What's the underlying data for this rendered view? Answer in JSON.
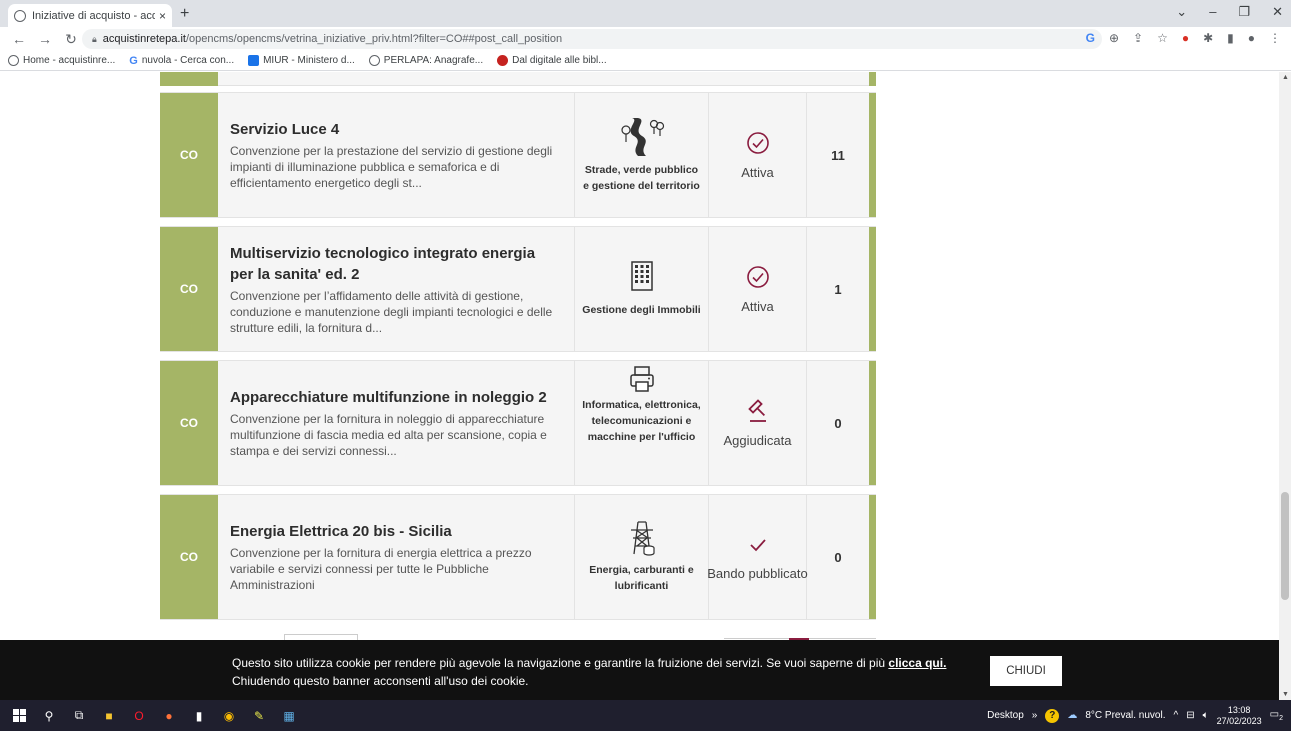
{
  "browser": {
    "tab_title": "Iniziative di acquisto - acquistinr",
    "tab_close": "×",
    "new_tab": "+",
    "url_host": "acquistinretepa.it",
    "url_path": "/opencms/opencms/vetrina_iniziative_priv.html?filter=CO##post_call_position",
    "bookmarks": [
      {
        "label": "Home - acquistinre...",
        "color": "#5f6368"
      },
      {
        "label": "nuvola - Cerca con...",
        "color": "#4285f4"
      },
      {
        "label": "MIUR - Ministero d...",
        "color": "#1a73e8"
      },
      {
        "label": "PERLAPA: Anagrafe...",
        "color": "#5f6368"
      },
      {
        "label": "Dal digitale alle bibl...",
        "color": "#c5221f"
      }
    ]
  },
  "cards": [
    {
      "code": "CO",
      "title": "Servizio Luce 4",
      "description": "Convenzione per la prestazione del servizio di gestione degli impianti di illuminazione pubblica e semaforica e di efficientamento energetico degli st...",
      "category_icon": "road-trees-icon",
      "category": "Strade, verde pubblico e gestione del territorio",
      "status_icon": "check-circle-icon",
      "status": "Attiva",
      "count": "11"
    },
    {
      "code": "CO",
      "title": "Multiservizio tecnologico integrato energia per la sanita' ed. 2",
      "description": "Convenzione per l’affidamento delle attività di gestione, conduzione e manutenzione degli impianti tecnologici e delle strutture edili, la fornitura d...",
      "category_icon": "building-icon",
      "category": "Gestione degli Immobili",
      "status_icon": "check-circle-icon",
      "status": "Attiva",
      "count": "1"
    },
    {
      "code": "CO",
      "title": "Apparecchiature multifunzione in noleggio 2",
      "description": "Convenzione per la fornitura in noleggio di apparecchiature multifunzione di fascia media ed alta per scansione, copia e stampa e dei servizi connessi...",
      "category_icon": "printer-icon",
      "category": "Informatica, elettronica, telecomunicazioni e macchine per l'ufficio",
      "status_icon": "gavel-icon",
      "status": "Aggiudicata",
      "count": "0"
    },
    {
      "code": "CO",
      "title": "Energia Elettrica 20 bis - Sicilia",
      "description": "Convenzione per la fornitura di energia elettrica a prezzo variabile e servizi connessi per tutte le Pubbliche Amministrazioni",
      "category_icon": "power-tower-icon",
      "category": "Energia, carburanti e lubrificanti",
      "status_icon": "checkmark-icon",
      "status": "Bando pubblicato",
      "count": "0"
    }
  ],
  "cookie": {
    "text_before": "Questo sito utilizza cookie per rendere più agevole la navigazione e garantire la fruizione dei servizi. Se vuoi saperne di più ",
    "link": "clicca qui.",
    "text_after": "Chiudendo questo banner acconsenti all'uso dei cookie.",
    "button": "CHIUDI"
  },
  "taskbar": {
    "desktop_label": "Desktop",
    "weather": "8°C Preval. nuvol.",
    "time": "13:08",
    "date": "27/02/2023",
    "notifications": "2"
  },
  "colors": {
    "accent_green": "#a5b566",
    "accent_maroon": "#8a1c3f"
  }
}
